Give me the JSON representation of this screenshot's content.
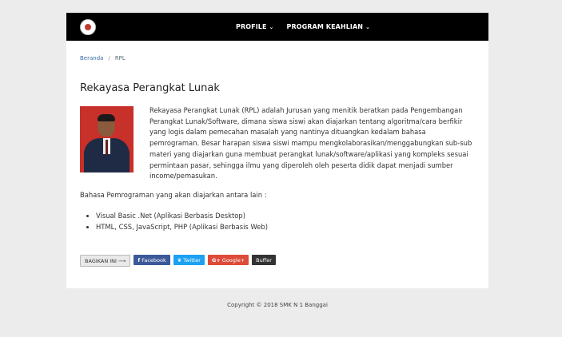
{
  "navbar": {
    "logo_icon": "school-logo-icon",
    "menu": [
      {
        "label": "PROFILE",
        "icon": "chevron-down-icon"
      },
      {
        "label": "PROGRAM KEAHLIAN",
        "icon": "chevron-down-icon"
      }
    ]
  },
  "breadcrumb": {
    "home": "Beranda",
    "separator": "/",
    "current": "RPL"
  },
  "page": {
    "title": "Rekayasa Perangkat Lunak",
    "description": "Rekayasa Perangkat Lunak (RPL) adalah Jurusan yang menitik beratkan pada Pengembangan Perangkat Lunak/Software, dimana siswa siswi akan diajarkan tentang algoritma/cara berfikir yang logis dalam pemecahan masalah yang nantinya dituangkan kedalam bahasa pemrograman. Besar harapan siswa siswi mampu mengkolaborasikan/menggabungkan sub-sub materi yang diajarkan guna membuat perangkat lunak/software/aplikasi yang kompleks sesuai permintaan pasar, sehingga ilmu yang diperoleh oleh peserta didik dapat menjadi sumber income/pemasukan.",
    "languages_intro": "Bahasa Pemrograman yang akan diajarkan antara lain :",
    "languages": [
      "Visual Basic .Net (Aplikasi Berbasis Desktop)",
      "HTML, CSS, JavaScript, PHP (Aplikasi Berbasis Web)"
    ]
  },
  "share": {
    "share_label": "BAGIKAN INI ⟶",
    "facebook": "Facebook",
    "twitter": "Twitter",
    "googleplus": "Google+",
    "buffer": "Buffer",
    "facebook_icon": "f",
    "twitter_icon": "❦",
    "googleplus_icon": "G+"
  },
  "footer": {
    "copyright": "Copyright © 2018 SMK N 1 Banggai"
  },
  "colors": {
    "navbar": "#000000",
    "facebook": "#3b5998",
    "twitter": "#1da1f2",
    "googleplus": "#dd4b39",
    "buffer": "#333333",
    "link": "#3a6ea5"
  }
}
